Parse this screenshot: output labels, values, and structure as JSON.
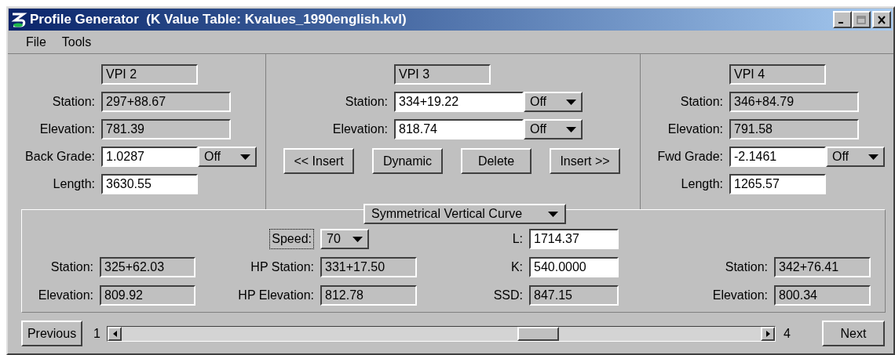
{
  "window": {
    "title": "Profile Generator  (K Value Table: Kvalues_1990english.kvl)"
  },
  "menu": [
    "File",
    "Tools"
  ],
  "vpi_panels": [
    {
      "kind": "side",
      "name": "VPI 2",
      "fields": [
        {
          "label": "Station:",
          "value": "297+88.67",
          "kind": "readonly"
        },
        {
          "label": "Elevation:",
          "value": "781.39",
          "kind": "readonly"
        },
        {
          "label": "Back Grade:",
          "value": "1.0287",
          "kind": "input",
          "dropdown": "Off"
        },
        {
          "label": "Length:",
          "value": "3630.55",
          "kind": "input"
        }
      ]
    },
    {
      "kind": "current",
      "name": "VPI 3",
      "fields": [
        {
          "label": "Station:",
          "value": "334+19.22",
          "kind": "input",
          "dropdown": "Off"
        },
        {
          "label": "Elevation:",
          "value": "818.74",
          "kind": "input",
          "dropdown": "Off"
        }
      ],
      "buttons": [
        "<< Insert",
        "Dynamic",
        "Delete",
        "Insert >>"
      ]
    },
    {
      "kind": "side",
      "name": "VPI 4",
      "fields": [
        {
          "label": "Station:",
          "value": "346+84.79",
          "kind": "readonly"
        },
        {
          "label": "Elevation:",
          "value": "791.58",
          "kind": "readonly"
        },
        {
          "label": "Fwd Grade:",
          "value": "-2.1461",
          "kind": "input",
          "dropdown": "Off"
        },
        {
          "label": "Length:",
          "value": "1265.57",
          "kind": "input"
        }
      ]
    }
  ],
  "curve": {
    "type": "Symmetrical Vertical Curve",
    "columns": [
      [
        {
          "label": "Station:",
          "value": "325+62.03",
          "kind": "readonly"
        },
        {
          "label": "Elevation:",
          "value": "809.92",
          "kind": "readonly"
        }
      ],
      [
        {
          "label": "Speed:",
          "value": "70",
          "kind": "dropdown",
          "focused": true
        },
        {
          "label": "HP Station:",
          "value": "331+17.50",
          "kind": "readonly"
        },
        {
          "label": "HP Elevation:",
          "value": "812.78",
          "kind": "readonly"
        }
      ],
      [
        {
          "label": "L:",
          "value": "1714.37",
          "kind": "input"
        },
        {
          "label": "K:",
          "value": "540.0000",
          "kind": "input"
        },
        {
          "label": "SSD:",
          "value": "847.15",
          "kind": "readonly"
        }
      ],
      [
        {
          "label": "Station:",
          "value": "342+76.41",
          "kind": "readonly"
        },
        {
          "label": "Elevation:",
          "value": "800.34",
          "kind": "readonly"
        }
      ]
    ]
  },
  "navigation": {
    "previous": "Previous",
    "first": "1",
    "last": "4",
    "next": "Next"
  }
}
